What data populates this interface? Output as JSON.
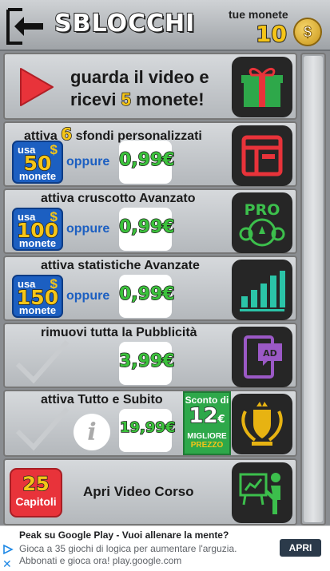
{
  "header": {
    "title": "SBLOCCHI",
    "coins_label": "tue monete",
    "coins_value": "10",
    "coin_symbol": "$"
  },
  "video_row": {
    "line1": "guarda il video e",
    "line2_pre": "ricevi",
    "line2_num": "5",
    "line2_post": "monete!"
  },
  "rows": [
    {
      "title_pre": "attiva",
      "title_num": "6",
      "title_post": "sfondi personalizzati",
      "usa": "usa",
      "coins": "50",
      "monete": "monete",
      "oppure": "oppure",
      "price": "0,99",
      "currency": "€"
    },
    {
      "title": "attiva cruscotto Avanzato",
      "usa": "usa",
      "coins": "100",
      "monete": "monete",
      "oppure": "oppure",
      "price": "0,99",
      "currency": "€",
      "icon_text": "PRO"
    },
    {
      "title": "attiva statistiche Avanzate",
      "usa": "usa",
      "coins": "150",
      "monete": "monete",
      "oppure": "oppure",
      "price": "0,99",
      "currency": "€"
    },
    {
      "title": "rimuovi tutta la Pubblicità",
      "price": "3,99",
      "currency": "€",
      "icon_text": "AD"
    },
    {
      "title": "attiva Tutto e Subito",
      "price": "19,99",
      "currency": "€",
      "info": "i",
      "discount_label": "Sconto di",
      "discount_value": "12",
      "discount_currency": "€",
      "best_price_line1": "MIGLIORE",
      "best_price_line2": "PREZZO"
    }
  ],
  "course_row": {
    "badge_num": "25",
    "badge_label": "Capitoli",
    "title": "Apri Video Corso"
  },
  "ad": {
    "title": "Peak su Google Play - Vuoi allenare la mente?",
    "body": "Gioca a 35 giochi di logica per aumentare l'arguzia. Abbonati e gioca ora! play.google.com",
    "button": "APRI"
  },
  "colors": {
    "price_green": "#3cc23c",
    "coin_gold": "#f5c518",
    "badge_blue": "#1c5fc1",
    "video_red": "#e8333a",
    "gift_green": "#2ea84a",
    "icon_red": "#e8333a",
    "icon_green": "#3cbf4c",
    "icon_teal": "#2bc4a8",
    "icon_purple": "#9b59c6",
    "icon_gold": "#e7b312"
  },
  "icons": {
    "back": "back-arrow-icon",
    "coin": "coin-icon",
    "video": "play-icon",
    "gift": "gift-icon",
    "wallpaper": "layout-icon",
    "dashboard": "pro-dashboard-icon",
    "stats": "bar-chart-icon",
    "ads": "ad-tablet-icon",
    "all": "laurel-shield-icon",
    "course": "teacher-board-icon"
  }
}
